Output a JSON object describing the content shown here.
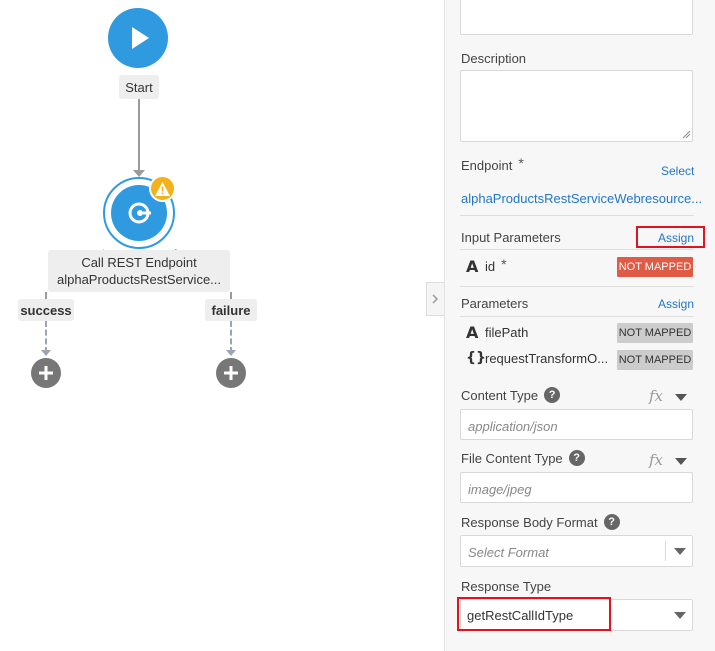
{
  "canvas": {
    "start_label": "Start",
    "rest_node": {
      "title": "Call REST Endpoint",
      "subtitle": "alphaProductsRestService..."
    },
    "branches": {
      "success": "success",
      "failure": "failure"
    }
  },
  "panel": {
    "description_label": "Description",
    "description_value": "",
    "endpoint": {
      "label": "Endpoint",
      "required_mark": "*",
      "select_link": "Select",
      "value": "alphaProductsRestServiceWebresource..."
    },
    "input_parameters": {
      "label": "Input Parameters",
      "assign_link": "Assign",
      "items": [
        {
          "type_icon": "A",
          "name": "id",
          "required_mark": "*",
          "status": "NOT MAPPED",
          "status_color": "#e05b45"
        }
      ]
    },
    "parameters": {
      "label": "Parameters",
      "assign_link": "Assign",
      "items": [
        {
          "type_icon": "A",
          "name": "filePath",
          "status": "NOT MAPPED"
        },
        {
          "type_icon": "{}",
          "name": "requestTransformO...",
          "status": "NOT MAPPED"
        }
      ]
    },
    "content_type": {
      "label": "Content Type",
      "fx": "fx",
      "placeholder": "application/json"
    },
    "file_content_type": {
      "label": "File Content Type",
      "fx": "fx",
      "placeholder": "image/jpeg"
    },
    "response_body_format": {
      "label": "Response Body Format",
      "placeholder": "Select Format"
    },
    "response_type": {
      "label": "Response Type",
      "value": "getRestCallIdType"
    }
  },
  "colors": {
    "node_blue": "#2f9ae0",
    "warning": "#f3b21c",
    "link_blue": "#2276c9",
    "highlight_red": "#e0141e",
    "not_mapped_red": "#e05b45"
  }
}
